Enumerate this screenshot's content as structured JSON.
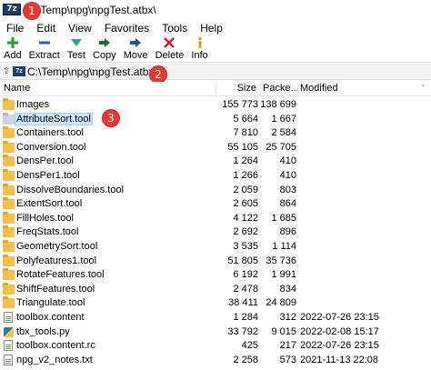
{
  "window": {
    "title": "C:\\Temp\\npg\\npgTest.atbx\\",
    "app_icon_text": "7z"
  },
  "menu": [
    "File",
    "Edit",
    "View",
    "Favorites",
    "Tools",
    "Help"
  ],
  "toolbar": [
    {
      "label": "Add",
      "icon": "add-icon",
      "color": "#1e9e2f"
    },
    {
      "label": "Extract",
      "icon": "extract-icon",
      "color": "#2458c6"
    },
    {
      "label": "Test",
      "icon": "test-icon",
      "color": "#29a3a3"
    },
    {
      "label": "Copy",
      "icon": "copy-icon",
      "color": "#1d6e2a"
    },
    {
      "label": "Move",
      "icon": "move-icon",
      "color": "#1f4fa8"
    },
    {
      "label": "Delete",
      "icon": "delete-icon",
      "color": "#d32020"
    },
    {
      "label": "Info",
      "icon": "info-icon",
      "color": "#d4a017"
    }
  ],
  "address": {
    "path": "C:\\Temp\\npg\\npgTest.atbx\\"
  },
  "columns": {
    "name": "Name",
    "size": "Size",
    "packed": "Packe...",
    "modified": "Modified"
  },
  "files": [
    {
      "name": "Images",
      "type": "folder",
      "size": "155 773",
      "packed": "138 699",
      "modified": ""
    },
    {
      "name": "AttributeSort.tool",
      "type": "folder-dim",
      "size": "5 664",
      "packed": "1 667",
      "modified": "",
      "selected": true
    },
    {
      "name": "Containers.tool",
      "type": "folder",
      "size": "7 810",
      "packed": "2 584",
      "modified": ""
    },
    {
      "name": "Conversion.tool",
      "type": "folder",
      "size": "55 105",
      "packed": "25 705",
      "modified": ""
    },
    {
      "name": "DensPer.tool",
      "type": "folder",
      "size": "1 264",
      "packed": "410",
      "modified": ""
    },
    {
      "name": "DensPer1.tool",
      "type": "folder",
      "size": "1 266",
      "packed": "410",
      "modified": ""
    },
    {
      "name": "DissolveBoundaries.tool",
      "type": "folder",
      "size": "2 059",
      "packed": "803",
      "modified": ""
    },
    {
      "name": "ExtentSort.tool",
      "type": "folder",
      "size": "2 605",
      "packed": "864",
      "modified": ""
    },
    {
      "name": "FillHoles.tool",
      "type": "folder",
      "size": "4 122",
      "packed": "1 685",
      "modified": ""
    },
    {
      "name": "FreqStats.tool",
      "type": "folder",
      "size": "2 692",
      "packed": "896",
      "modified": ""
    },
    {
      "name": "GeometrySort.tool",
      "type": "folder",
      "size": "3 535",
      "packed": "1 114",
      "modified": ""
    },
    {
      "name": "Polyfeatures1.tool",
      "type": "folder",
      "size": "51 805",
      "packed": "35 736",
      "modified": ""
    },
    {
      "name": "RotateFeatures.tool",
      "type": "folder",
      "size": "6 192",
      "packed": "1 991",
      "modified": ""
    },
    {
      "name": "ShiftFeatures.tool",
      "type": "folder",
      "size": "2 478",
      "packed": "834",
      "modified": ""
    },
    {
      "name": "Triangulate.tool",
      "type": "folder",
      "size": "38 411",
      "packed": "24 809",
      "modified": ""
    },
    {
      "name": "toolbox.content",
      "type": "file",
      "size": "1 284",
      "packed": "312",
      "modified": "2022-07-26 23:15"
    },
    {
      "name": "tbx_tools.py",
      "type": "pyfile",
      "size": "33 792",
      "packed": "9 015",
      "modified": "2022-02-08 15:17"
    },
    {
      "name": "toolbox.content.rc",
      "type": "file",
      "size": "425",
      "packed": "217",
      "modified": "2022-07-26 23:15"
    },
    {
      "name": "npg_v2_notes.txt",
      "type": "file",
      "size": "2 258",
      "packed": "573",
      "modified": "2021-11-13 22:08"
    }
  ],
  "callouts": [
    "1",
    "2",
    "3"
  ]
}
